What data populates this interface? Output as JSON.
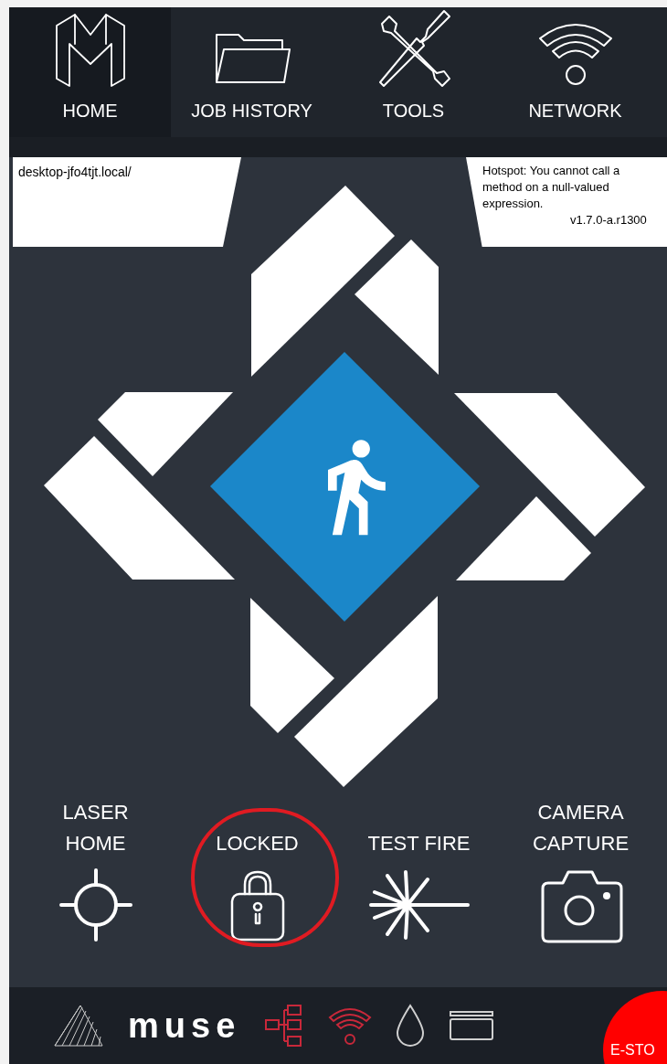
{
  "tabs": [
    {
      "label": "HOME",
      "kind": "logo",
      "selected": true
    },
    {
      "label": "JOB HISTORY",
      "kind": "folder",
      "selected": false
    },
    {
      "label": "TOOLS",
      "kind": "tools",
      "selected": false
    },
    {
      "label": "NETWORK",
      "kind": "wifi",
      "selected": false
    }
  ],
  "host": "desktop-jfo4tjt.local/",
  "hotspot": {
    "message": "Hotspot: You cannot call a method on a null-valued expression.",
    "version": "v1.7.0-a.r1300"
  },
  "actions": [
    {
      "label": "LASER HOME",
      "kind": "crosshair",
      "highlighted": false
    },
    {
      "label": "LOCKED",
      "kind": "lock",
      "highlighted": true
    },
    {
      "label": "TEST FIRE",
      "kind": "laser",
      "highlighted": false
    },
    {
      "label": "CAMERA CAPTURE",
      "kind": "camera",
      "highlighted": false
    }
  ],
  "footer": {
    "brand": "muse",
    "status": [
      {
        "kind": "network",
        "color": "#c8283a"
      },
      {
        "kind": "wifi",
        "color": "#c8283a"
      },
      {
        "kind": "water",
        "color": "#d0d0d0"
      },
      {
        "kind": "card",
        "color": "#d0d0d0"
      }
    ],
    "estop": "E-STO"
  }
}
